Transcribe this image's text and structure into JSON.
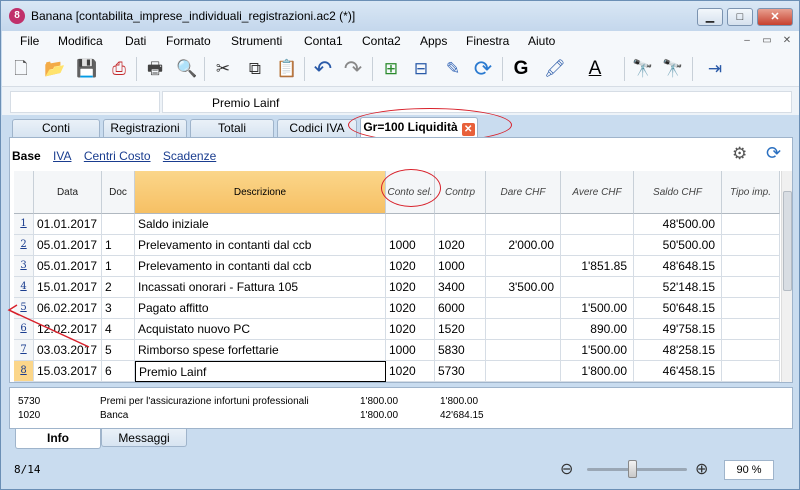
{
  "window": {
    "app_icon": "8",
    "title": "Banana [contabilita_imprese_individuali_registrazioni.ac2 (*)]",
    "buttons": [
      "▁",
      "□",
      "✕"
    ]
  },
  "menu": {
    "items": [
      "File",
      "Modifica",
      "Dati",
      "Formato",
      "Strumenti",
      "Conta1",
      "Conta2",
      "Apps",
      "Finestra",
      "Aiuto"
    ],
    "mdi_buttons": [
      "–",
      "▭",
      "✕"
    ]
  },
  "toolbar": {
    "icons": [
      "new-file-icon",
      "open-folder-icon",
      "save-icon",
      "pdf-icon",
      "print-icon",
      "print-preview-icon",
      "cut-icon",
      "copy-icon",
      "paste-icon",
      "undo-icon",
      "redo-icon",
      "insert-row-icon",
      "delete-row-icon",
      "edit-cell-icon",
      "recheck-icon",
      "bold-icon",
      "fill-color-icon",
      "text-color-icon",
      "find-icon",
      "find-next-icon",
      "go-to-icon"
    ],
    "glyphs": [
      "🗋",
      "📂",
      "💾",
      "⎙",
      "🖶",
      "🔍",
      "✂",
      "⧉",
      "📋",
      "↶",
      "↷",
      "⊞",
      "⊟",
      "✎",
      "⟳",
      "G",
      "🖍",
      "A",
      "🔭",
      "🔭",
      "⇥"
    ]
  },
  "edit_bar": {
    "cell_ref": "",
    "value": "Premio Lainf"
  },
  "tabs": [
    "Conti",
    "Registrazioni",
    "Totali",
    "Codici IVA",
    "Gr=100 Liquidità"
  ],
  "tab_close_glyph": "✕",
  "views": {
    "active": "Base",
    "links": [
      "IVA",
      "Centri Costo",
      "Scadenze"
    ]
  },
  "table": {
    "columns": [
      "",
      "Data",
      "Doc",
      "Descrizione",
      "Conto sel.",
      "Contrp",
      "Dare CHF",
      "Avere CHF",
      "Saldo CHF",
      "Tipo imp."
    ],
    "rows": [
      {
        "n": "1",
        "data": "01.01.2017",
        "doc": "",
        "desc": "Saldo iniziale",
        "conto": "",
        "contrp": "",
        "dare": "",
        "avere": "",
        "saldo": "48'500.00",
        "tipo": ""
      },
      {
        "n": "2",
        "data": "05.01.2017",
        "doc": "1",
        "desc": "Prelevamento in contanti dal ccb",
        "conto": "1000",
        "contrp": "1020",
        "dare": "2'000.00",
        "avere": "",
        "saldo": "50'500.00",
        "tipo": ""
      },
      {
        "n": "3",
        "data": "05.01.2017",
        "doc": "1",
        "desc": "Prelevamento in contanti dal ccb",
        "conto": "1020",
        "contrp": "1000",
        "dare": "",
        "avere": "1'851.85",
        "saldo": "48'648.15",
        "tipo": ""
      },
      {
        "n": "4",
        "data": "15.01.2017",
        "doc": "2",
        "desc": "Incassati onorari - Fattura 105",
        "conto": "1020",
        "contrp": "3400",
        "dare": "3'500.00",
        "avere": "",
        "saldo": "52'148.15",
        "tipo": ""
      },
      {
        "n": "5",
        "data": "06.02.2017",
        "doc": "3",
        "desc": "Pagato affitto",
        "conto": "1020",
        "contrp": "6000",
        "dare": "",
        "avere": "1'500.00",
        "saldo": "50'648.15",
        "tipo": ""
      },
      {
        "n": "6",
        "data": "12.02.2017",
        "doc": "4",
        "desc": "Acquistato nuovo PC",
        "conto": "1020",
        "contrp": "1520",
        "dare": "",
        "avere": "890.00",
        "saldo": "49'758.15",
        "tipo": ""
      },
      {
        "n": "7",
        "data": "03.03.2017",
        "doc": "5",
        "desc": "Rimborso spese forfettarie",
        "conto": "1000",
        "contrp": "5830",
        "dare": "",
        "avere": "1'500.00",
        "saldo": "48'258.15",
        "tipo": ""
      },
      {
        "n": "8",
        "data": "15.03.2017",
        "doc": "6",
        "desc": "Premio Lainf",
        "conto": "1020",
        "contrp": "5730",
        "dare": "",
        "avere": "1'800.00",
        "saldo": "46'458.15",
        "tipo": ""
      }
    ]
  },
  "info_panel": {
    "rows": [
      {
        "account": "5730",
        "desc": "Premi per l'assicurazione infortuni professionali",
        "a": "1'800.00",
        "b": "1'800.00"
      },
      {
        "account": "1020",
        "desc": "Banca",
        "a": "1'800.00",
        "b": "42'684.15"
      }
    ]
  },
  "bottom_tabs": [
    "Info",
    "Messaggi"
  ],
  "status": {
    "row_count": "8/14",
    "zoom": "90 %",
    "zoom_level": 0.45,
    "zoom_minus_glyph": "⊖",
    "zoom_plus_glyph": "⊕"
  },
  "colors": {
    "accent": "#fbd68a",
    "annotation": "#d8202a",
    "link": "#1a3d8f"
  }
}
